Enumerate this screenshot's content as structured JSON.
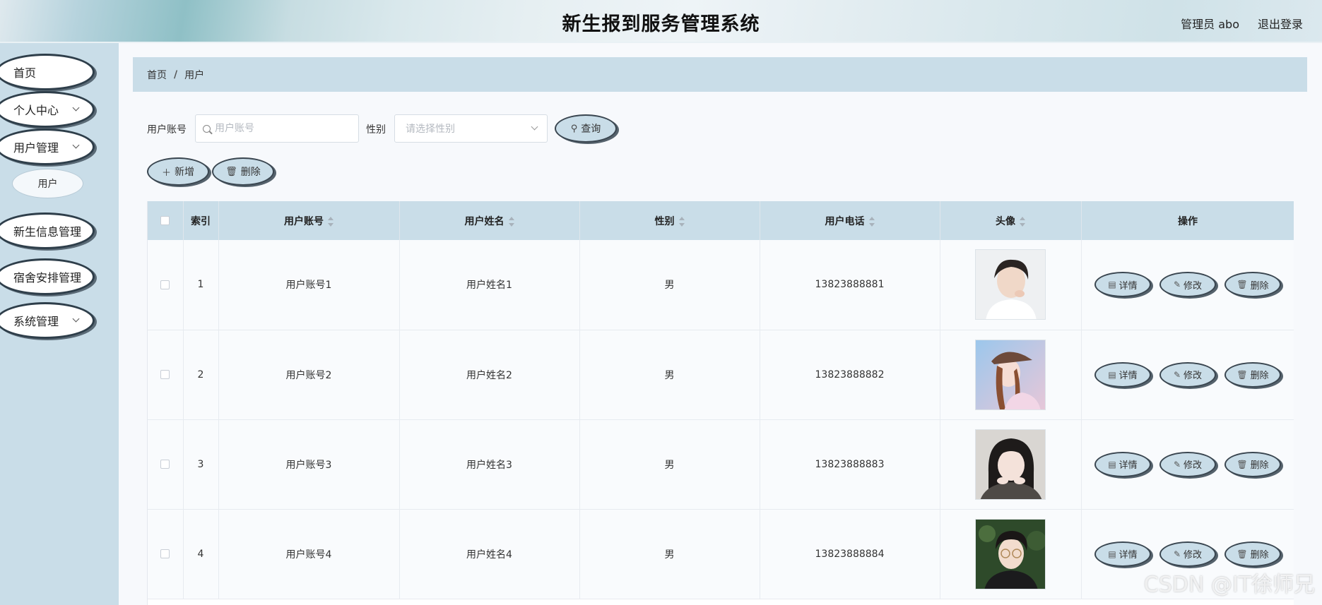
{
  "header": {
    "title": "新生报到服务管理系统",
    "user": "管理员 abo",
    "logout": "退出登录"
  },
  "sidebar": {
    "items": [
      {
        "label": "首页"
      },
      {
        "label": "个人中心"
      },
      {
        "label": "用户管理"
      },
      {
        "label": "新生信息管理"
      },
      {
        "label": "宿舍安排管理"
      },
      {
        "label": "系统管理"
      }
    ],
    "subitem": "用户"
  },
  "breadcrumb": {
    "home": "首页",
    "separator": "/",
    "current": "用户"
  },
  "filters": {
    "account_label": "用户账号",
    "account_placeholder": "用户账号",
    "gender_label": "性别",
    "gender_placeholder": "请选择性别",
    "search_button": "查询"
  },
  "toolbar": {
    "add_label": "新增",
    "delete_label": "删除"
  },
  "table": {
    "headers": {
      "index": "索引",
      "account": "用户账号",
      "name": "用户姓名",
      "gender": "性别",
      "phone": "用户电话",
      "avatar": "头像",
      "actions": "操作"
    },
    "rows": [
      {
        "index": "1",
        "account": "用户账号1",
        "name": "用户姓名1",
        "gender": "男",
        "phone": "13823888881"
      },
      {
        "index": "2",
        "account": "用户账号2",
        "name": "用户姓名2",
        "gender": "男",
        "phone": "13823888882"
      },
      {
        "index": "3",
        "account": "用户账号3",
        "name": "用户姓名3",
        "gender": "男",
        "phone": "13823888883"
      },
      {
        "index": "4",
        "account": "用户账号4",
        "name": "用户姓名4",
        "gender": "男",
        "phone": "13823888884"
      }
    ],
    "row_actions": {
      "detail": "详情",
      "edit": "修改",
      "delete": "删除"
    }
  },
  "watermark": "CSDN @IT徐师兄"
}
